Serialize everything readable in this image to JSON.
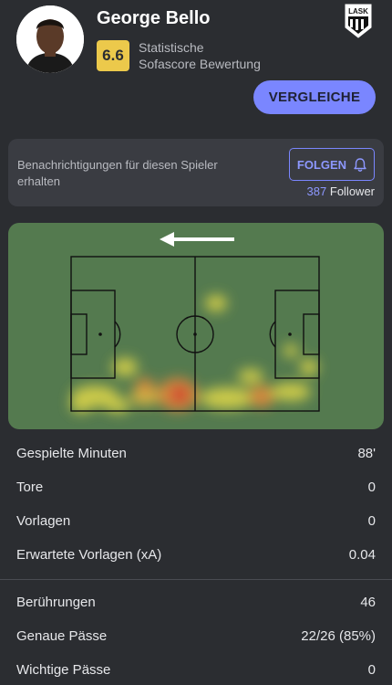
{
  "player": {
    "name": "George Bello",
    "rating": "6.6",
    "rating_caption_line1": "Statistische",
    "rating_caption_line2": "Sofascore Bewertung",
    "club_logo_text": "LASK"
  },
  "actions": {
    "compare_label": "VERGLEICHE",
    "follow_label": "FOLGEN",
    "notify_text": "Benachrichtigungen für diesen Spieler erhalten",
    "follower_count": "387",
    "follower_label": "Follower"
  },
  "heatmap": {
    "direction_icon": "arrow-left-icon",
    "pitch_color": "#547a4f"
  },
  "stats_group1": [
    {
      "label": "Gespielte Minuten",
      "value": "88'"
    },
    {
      "label": "Tore",
      "value": "0"
    },
    {
      "label": "Vorlagen",
      "value": "0"
    },
    {
      "label": "Erwartete Vorlagen (xA)",
      "value": "0.04"
    }
  ],
  "stats_group2": [
    {
      "label": "Berührungen",
      "value": "46"
    },
    {
      "label": "Genaue Pässe",
      "value": "22/26 (85%)"
    },
    {
      "label": "Wichtige Pässe",
      "value": "0"
    }
  ],
  "colors": {
    "background": "#2b2d31",
    "accent": "#7a86ff",
    "rating": "#ecc94b"
  }
}
